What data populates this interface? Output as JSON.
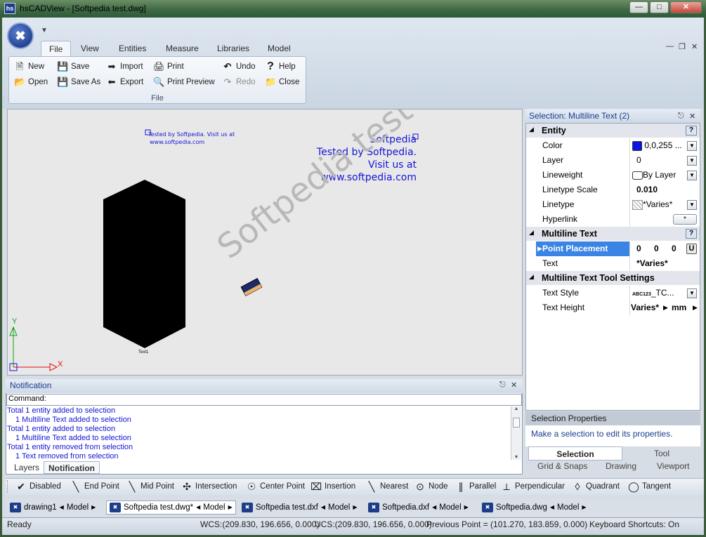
{
  "window": {
    "title": "hsCADView - [Softpedia test.dwg]",
    "app_icon_text": "hs"
  },
  "menu_tabs": [
    "File",
    "View",
    "Entities",
    "Measure",
    "Libraries",
    "Model"
  ],
  "ribbon": {
    "group_label": "File",
    "col1": [
      "New",
      "Open"
    ],
    "col2": [
      "Save",
      "Save As"
    ],
    "col3": [
      "Import",
      "Export"
    ],
    "col4": [
      "Print",
      "Print Preview"
    ],
    "col5": [
      "Undo",
      "Redo"
    ],
    "col6": [
      "Help",
      "Close"
    ]
  },
  "canvas": {
    "small_text_line1": "Tested by Softpedia. Visit us at",
    "small_text_line2": "www.softpedia.com",
    "big_text_line1": "Softpedia",
    "big_text_line2": "Tested by Softpedia.",
    "big_text_line3": "Visit us at www.softpedia.com",
    "watermark": "Softpedia test",
    "shape_label": "Text1",
    "axis_x": "X",
    "axis_y": "Y"
  },
  "notification": {
    "title": "Notification",
    "command_label": "Command:",
    "log": [
      {
        "text": "Total 1 entity added to selection",
        "indent": false
      },
      {
        "text": "1 Multiline Text added to selection",
        "indent": true
      },
      {
        "text": "Total 1 entity added to selection",
        "indent": false
      },
      {
        "text": "1 Multiline Text added to selection",
        "indent": true
      },
      {
        "text": "Total 1 entity removed from selection",
        "indent": false
      },
      {
        "text": "1 Text removed from selection",
        "indent": true
      }
    ],
    "tabs": [
      "Layers",
      "Notification"
    ]
  },
  "snaps": [
    "Disabled",
    "End Point",
    "Mid Point",
    "Intersection",
    "Center Point",
    "Insertion",
    "Nearest",
    "Node",
    "Parallel",
    "Perpendicular",
    "Quadrant",
    "Tangent"
  ],
  "doc_tabs": [
    {
      "name": "drawing1",
      "model": "Model"
    },
    {
      "name": "Softpedia test.dwg*",
      "model": "Model"
    },
    {
      "name": "Softpedia test.dxf",
      "model": "Model"
    },
    {
      "name": "Softpedia.dxf",
      "model": "Model"
    },
    {
      "name": "Softpedia.dwg",
      "model": "Model"
    }
  ],
  "status": {
    "ready": "Ready",
    "wcs": "WCS:(209.830, 196.656, 0.000)",
    "ucs": "UCS:(209.830, 196.656, 0.000)",
    "previous": "Previous Point = (101.270, 183.859, 0.000)",
    "shortcuts": "Keyboard Shortcuts: On"
  },
  "properties": {
    "title": "Selection: Multiline Text (2)",
    "cat_entity": "Entity",
    "cat_mtext": "Multiline Text",
    "cat_tool": "Multiline Text Tool Settings",
    "color_label": "Color",
    "color_value": "0,0,255 ...",
    "color_swatch": "#0a12e6",
    "layer_label": "Layer",
    "layer_value": "0",
    "lineweight_label": "Lineweight",
    "lineweight_value": "By Layer",
    "ltscale_label": "Linetype Scale",
    "ltscale_value": "0.010",
    "linetype_label": "Linetype",
    "linetype_value": "*Varies*",
    "hyperlink_label": "Hyperlink",
    "hyperlink_btn": "*",
    "point_label": "Point Placement",
    "point_x": "0",
    "point_y": "0",
    "point_z": "0",
    "point_u": "U",
    "text_label": "Text",
    "text_value": "*Varies*",
    "style_label": "Text Style",
    "style_icon": "ABC123",
    "style_value": "_TC...",
    "height_label": "Text Height",
    "height_value": "Varies*",
    "height_unit": "mm"
  },
  "sel_props": {
    "title": "Selection Properties",
    "hint": "Make a selection to edit its properties."
  },
  "right_tabs": [
    "Selection",
    "Tool"
  ],
  "right_tabs2": [
    "Grid & Snaps",
    "Drawing",
    "Viewport"
  ]
}
